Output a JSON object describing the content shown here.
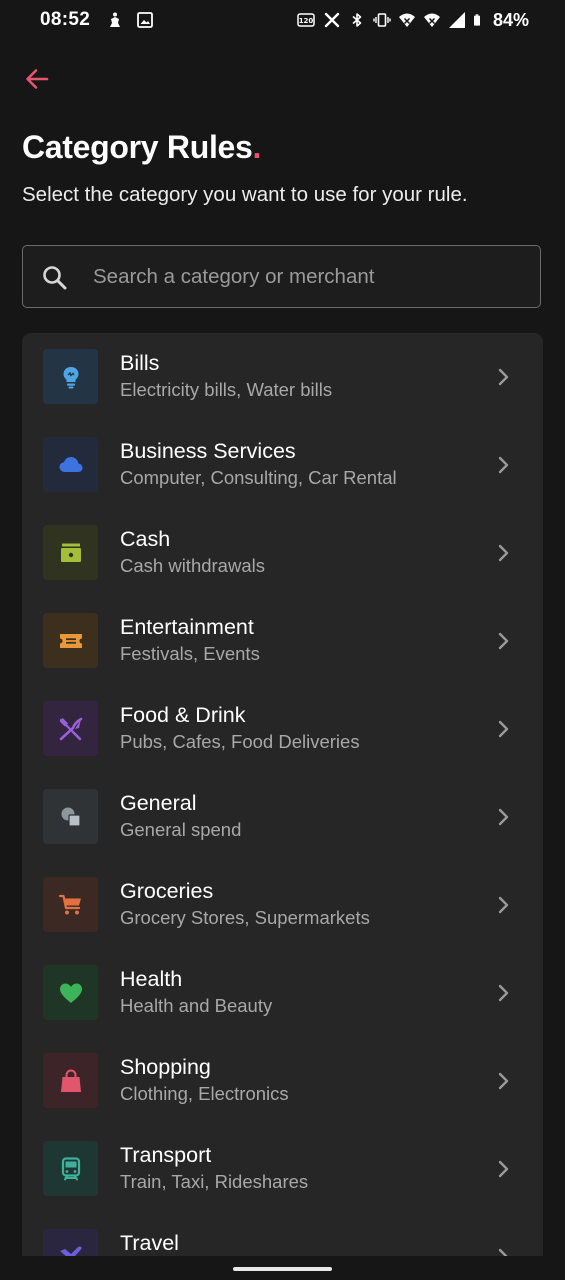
{
  "status_bar": {
    "time": "08:52",
    "battery_percent": "84%",
    "left_icons": [
      "notification-app-icon",
      "gallery-icon"
    ],
    "right_icons": [
      "refresh-rate-icon",
      "x-app-icon",
      "bluetooth-icon",
      "vibrate-icon",
      "wifi-icon",
      "wifi-icon",
      "signal-icon",
      "battery-icon"
    ]
  },
  "header": {
    "back_icon": "arrow-left-icon",
    "title": "Category Rules",
    "title_dot": ".",
    "subtitle": "Select the category you want to use for your rule."
  },
  "search": {
    "icon": "search-icon",
    "value": "",
    "placeholder": "Search a category or merchant"
  },
  "categories": [
    {
      "name": "Bills",
      "description": "Electricity bills, Water bills",
      "icon": "lightbulb-icon",
      "icon_color": "#4fa5e6",
      "tile_color": "#233544"
    },
    {
      "name": "Business Services",
      "description": "Computer, Consulting, Car Rental",
      "icon": "cloud-icon",
      "icon_color": "#3d72e0",
      "tile_color": "#222a3c"
    },
    {
      "name": "Cash",
      "description": "Cash withdrawals",
      "icon": "cash-icon",
      "icon_color": "#a4be3a",
      "tile_color": "#30331f"
    },
    {
      "name": "Entertainment",
      "description": "Festivals, Events",
      "icon": "ticket-icon",
      "icon_color": "#e8973a",
      "tile_color": "#3c2f1e"
    },
    {
      "name": "Food & Drink",
      "description": "Pubs, Cafes, Food Deliveries",
      "icon": "cutlery-icon",
      "icon_color": "#9b5fdc",
      "tile_color": "#33243f"
    },
    {
      "name": "General",
      "description": "General spend",
      "icon": "shapes-icon",
      "icon_color": "#8d959d",
      "tile_color": "#2f3336"
    },
    {
      "name": "Groceries",
      "description": "Grocery Stores, Supermarkets",
      "icon": "cart-icon",
      "icon_color": "#e5703f",
      "tile_color": "#3d2923"
    },
    {
      "name": "Health",
      "description": "Health and Beauty",
      "icon": "heart-icon",
      "icon_color": "#3db45a",
      "tile_color": "#1f3525"
    },
    {
      "name": "Shopping",
      "description": "Clothing, Electronics",
      "icon": "shopping-bag-icon",
      "icon_color": "#e2566c",
      "tile_color": "#3d2428"
    },
    {
      "name": "Transport",
      "description": "Train, Taxi, Rideshares",
      "icon": "train-icon",
      "icon_color": "#3bb39c",
      "tile_color": "#1f3733"
    },
    {
      "name": "Travel",
      "description": "",
      "icon": "plane-icon",
      "icon_color": "#6d5fdc",
      "tile_color": "#2a2640"
    }
  ],
  "chevron_icon": "chevron-right-icon",
  "theme": {
    "background": "#161616",
    "card": "#262626",
    "accent": "#e5556e"
  }
}
